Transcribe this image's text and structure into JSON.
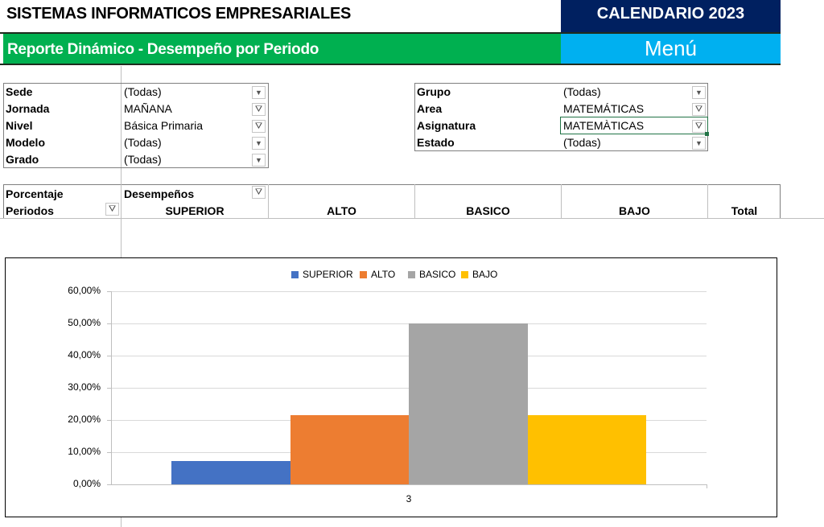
{
  "header": {
    "title": "SISTEMAS INFORMATICOS EMPRESARIALES",
    "calendar": "CALENDARIO 2023",
    "report": "Reporte Dinámico - Desempeño por Periodo",
    "menu": "Menú"
  },
  "filters_left": [
    {
      "label": "Sede",
      "value": "(Todas)",
      "icon": "dropdown-arrow-icon"
    },
    {
      "label": "Jornada",
      "value": "MAÑANA",
      "icon": "filter-icon"
    },
    {
      "label": "Nivel",
      "value": "Básica Primaria",
      "icon": "filter-icon"
    },
    {
      "label": "Modelo",
      "value": "(Todas)",
      "icon": "dropdown-arrow-icon"
    },
    {
      "label": "Grado",
      "value": "(Todas)",
      "icon": "dropdown-arrow-icon"
    }
  ],
  "filters_right": [
    {
      "label": "Grupo",
      "value": "(Todas)",
      "icon": "dropdown-arrow-icon"
    },
    {
      "label": "Area",
      "value": "MATEMÁTICAS",
      "icon": "filter-icon"
    },
    {
      "label": "Asignatura",
      "value": "MATEMÀTICAS",
      "icon": "filter-icon"
    },
    {
      "label": "Estado",
      "value": "(Todas)",
      "icon": "dropdown-arrow-icon"
    }
  ],
  "pivot": {
    "row1_label": "Porcentaje",
    "col_field": "Desempeños",
    "row_field": "Periodos",
    "columns": [
      "SUPERIOR",
      "ALTO",
      "BASICO",
      "BAJO",
      "Total"
    ]
  },
  "colors": {
    "superior": "#4472c4",
    "alto": "#ed7d31",
    "basico": "#a5a5a5",
    "bajo": "#ffc000"
  },
  "chart_data": {
    "type": "bar",
    "categories": [
      "3"
    ],
    "series": [
      {
        "name": "SUPERIOR",
        "values": [
          0.0714
        ]
      },
      {
        "name": "ALTO",
        "values": [
          0.2143
        ]
      },
      {
        "name": "BASICO",
        "values": [
          0.5
        ]
      },
      {
        "name": "BAJO",
        "values": [
          0.2143
        ]
      }
    ],
    "ylim": [
      0,
      0.6
    ],
    "yticks": [
      "0,00%",
      "10,00%",
      "20,00%",
      "30,00%",
      "40,00%",
      "50,00%",
      "60,00%"
    ],
    "legend": "top",
    "grid": true
  }
}
